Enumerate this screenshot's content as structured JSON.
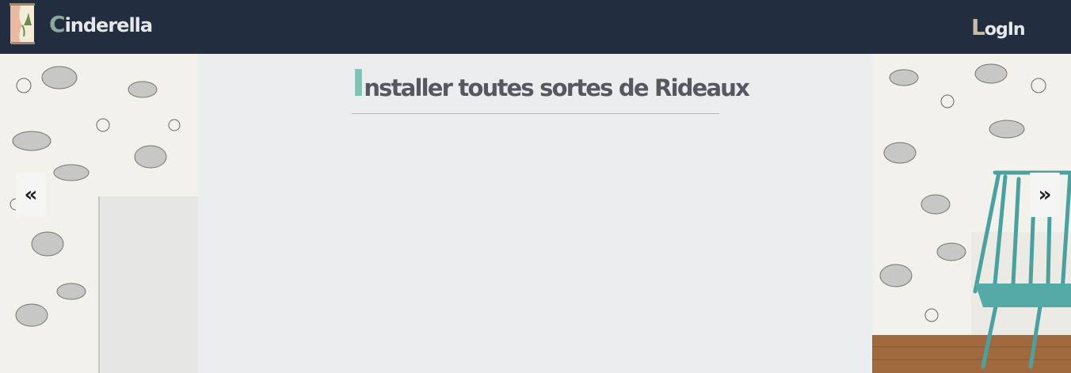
{
  "navbar": {
    "brand_first": "C",
    "brand_rest": "inderella",
    "login_first": "L",
    "login_rest": "ogIn"
  },
  "hero": {
    "heading_first": "I",
    "heading_rest": "nstaller toutes sortes de Rideaux"
  },
  "carousel": {
    "prev_label": "«",
    "next_label": "»"
  },
  "icons": {
    "logo": "curtain-logo-icon"
  }
}
